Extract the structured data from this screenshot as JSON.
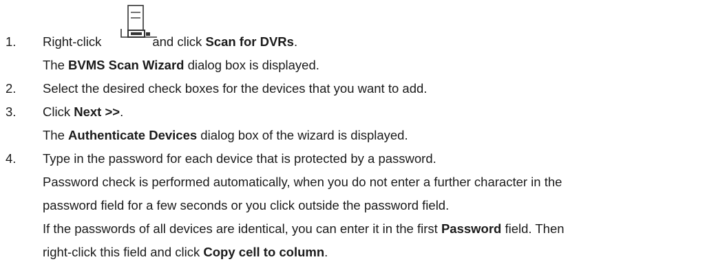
{
  "steps": [
    {
      "number": "1.",
      "instruction": {
        "pre": "Right-click",
        "mid": "and click",
        "bold": "Scan for DVRs",
        "post": "."
      },
      "icon": "dvr-device-icon",
      "result": {
        "pre": "The",
        "bold": "BVMS Scan Wizard",
        "post": "dialog box is displayed."
      }
    },
    {
      "number": "2.",
      "instruction": {
        "text": "Select the desired check boxes for the devices that you want to add."
      }
    },
    {
      "number": "3.",
      "instruction": {
        "pre": "Click",
        "bold": "Next >>",
        "post": "."
      },
      "result": {
        "pre": "The",
        "bold": "Authenticate Devices",
        "post": "dialog box of the wizard is displayed."
      }
    },
    {
      "number": "4.",
      "instruction": {
        "text": "Type in the password for each device that is protected by a password."
      },
      "note1_line1": "Password check is performed automatically, when you do not enter a further character in the",
      "note1_line2": "password field for a few seconds or you click outside the password field.",
      "note2_line1": {
        "pre": "If the passwords of all devices are identical, you can enter it in the first",
        "bold": "Password",
        "post": "field. Then"
      },
      "note2_line2": {
        "pre": "right-click this field and click",
        "bold": "Copy cell to column",
        "post": "."
      }
    }
  ]
}
